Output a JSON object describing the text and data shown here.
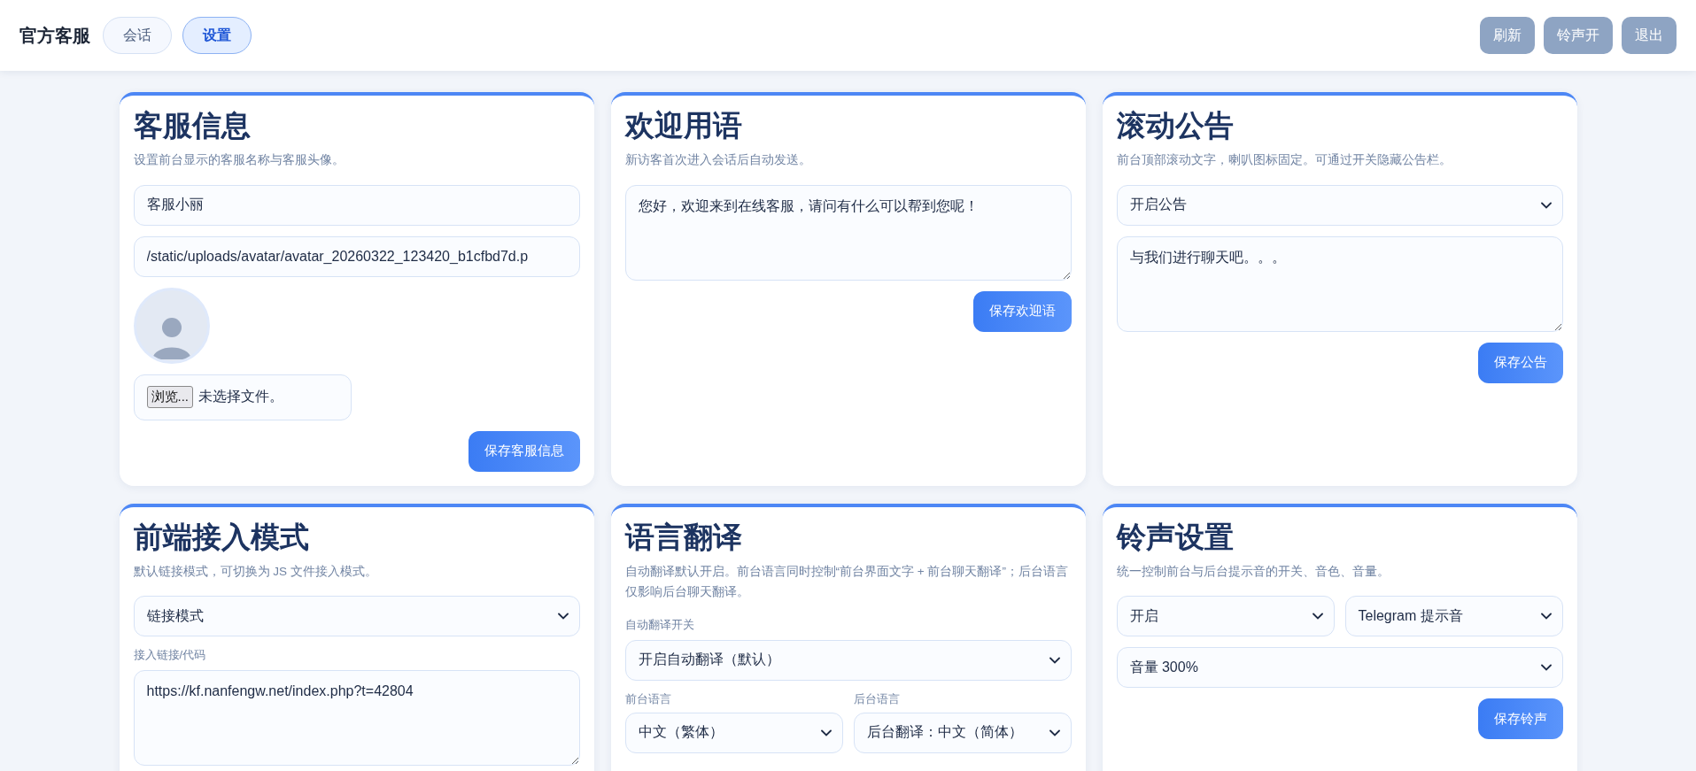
{
  "header": {
    "title": "官方客服",
    "tabs": [
      {
        "label": "会话",
        "selected": false
      },
      {
        "label": "设置",
        "selected": true
      }
    ],
    "buttons": [
      "刷新",
      "铃声开",
      "退出"
    ]
  },
  "cards": [
    {
      "title": "客服信息",
      "description": "设置前台显示的客服名称与客服头像。",
      "items": [
        {
          "kind": "input",
          "value": "客服小丽"
        },
        {
          "kind": "input",
          "value": "/static/uploads/avatar/avatar_20260322_123420_b1cfbd7d.p"
        },
        {
          "kind": "avatar"
        },
        {
          "kind": "file",
          "button": "浏览...",
          "status": "未选择文件。"
        }
      ],
      "save_button": "保存客服信息"
    },
    {
      "title": "欢迎用语",
      "description": "新访客首次进入会话后自动发送。",
      "items": [
        {
          "kind": "textarea",
          "value": "您好，欢迎来到在线客服，请问有什么可以帮到您呢！"
        }
      ],
      "save_button": "保存欢迎语"
    },
    {
      "title": "滚动公告",
      "description": "前台顶部滚动文字，喇叭图标固定。可通过开关隐藏公告栏。",
      "items": [
        {
          "kind": "select",
          "value": "开启公告"
        },
        {
          "kind": "textarea",
          "value": "与我们进行聊天吧。。。"
        }
      ],
      "save_button": "保存公告"
    },
    {
      "title": "前端接入模式",
      "description": "默认链接模式，可切换为 JS 文件接入模式。",
      "items": [
        {
          "kind": "select",
          "value": "链接模式"
        },
        {
          "kind": "label",
          "text": "接入链接/代码"
        },
        {
          "kind": "textarea",
          "value": "https://kf.nanfengw.net/index.php?t=42804"
        }
      ]
    },
    {
      "title": "语言翻译",
      "description": "自动翻译默认开启。前台语言同时控制“前台界面文字 + 前台聊天翻译”；后台语言仅影响后台聊天翻译。",
      "items": [
        {
          "kind": "label",
          "text": "自动翻译开关"
        },
        {
          "kind": "select",
          "value": "开启自动翻译（默认）"
        },
        {
          "kind": "select_row",
          "selects": [
            {
              "label": "前台语言",
              "value": "中文（繁体）"
            },
            {
              "label": "后台语言",
              "value": "后台翻译：中文（简体）"
            }
          ]
        }
      ]
    },
    {
      "title": "铃声设置",
      "description": "统一控制前台与后台提示音的开关、音色、音量。",
      "items": [
        {
          "kind": "select_row",
          "selects": [
            {
              "value": "开启"
            },
            {
              "value": "Telegram 提示音"
            }
          ]
        },
        {
          "kind": "select",
          "value": "音量 300%"
        }
      ],
      "save_button": "保存铃声"
    }
  ]
}
